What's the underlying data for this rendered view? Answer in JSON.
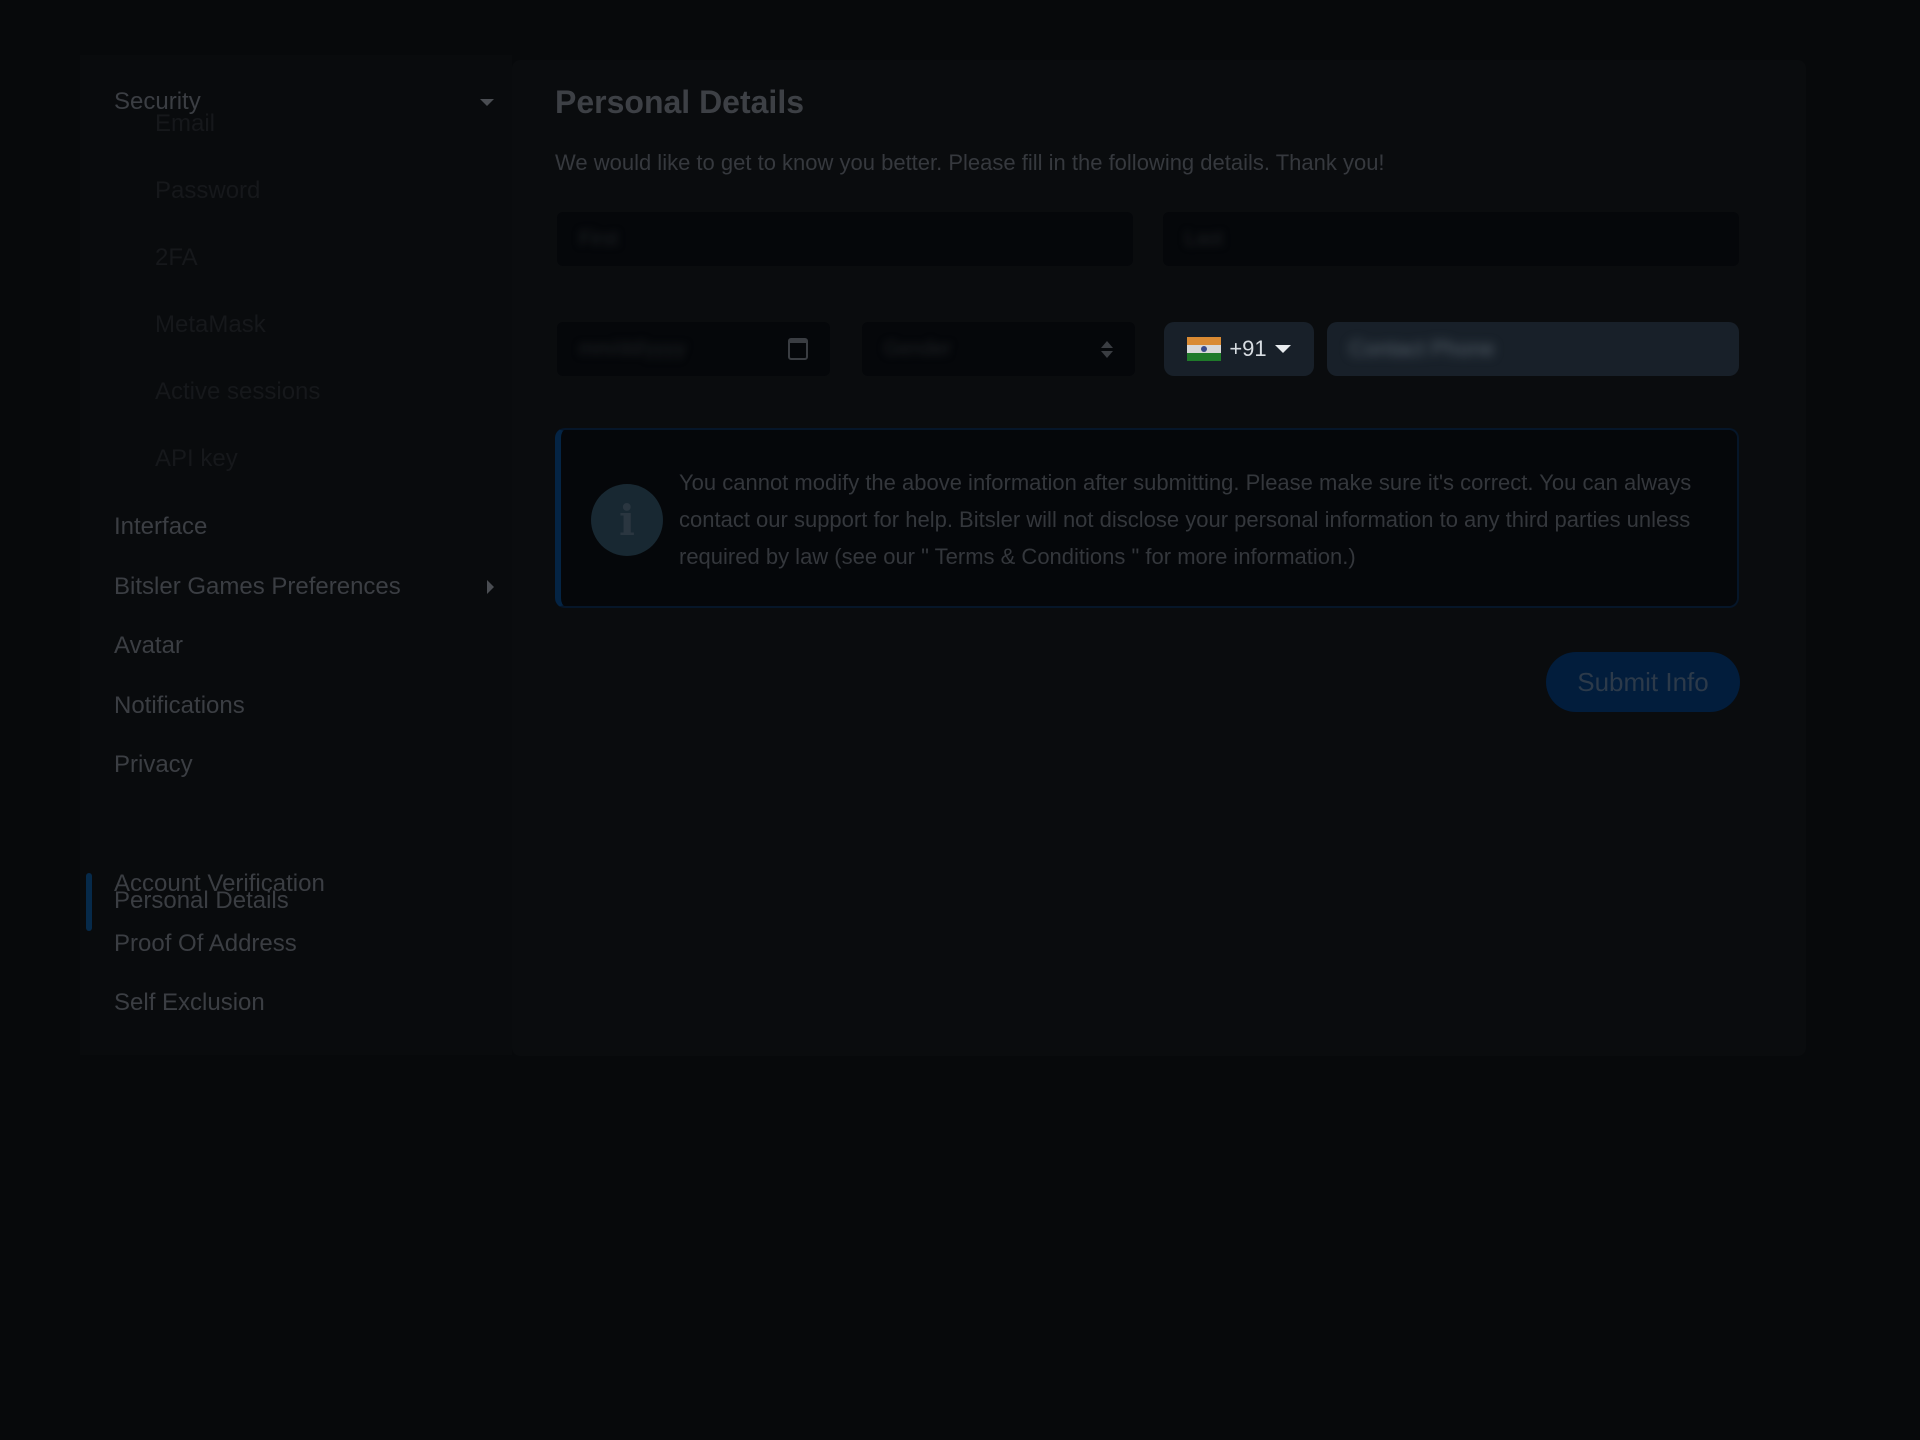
{
  "sidebar": {
    "security": {
      "label": "Security",
      "expanded": true,
      "items": [
        {
          "label": "Email"
        },
        {
          "label": "Password"
        },
        {
          "label": "2FA"
        },
        {
          "label": "MetaMask"
        },
        {
          "label": "Active sessions"
        },
        {
          "label": "API key"
        }
      ]
    },
    "items": [
      {
        "label": "Interface"
      },
      {
        "label": "Bitsler Games Preferences",
        "has_submenu": true
      },
      {
        "label": "Avatar"
      },
      {
        "label": "Notifications"
      },
      {
        "label": "Privacy"
      },
      {
        "label": "Personal Details",
        "active": true
      },
      {
        "label": "Account Verification"
      },
      {
        "label": "Proof Of Address"
      },
      {
        "label": "Self Exclusion"
      }
    ]
  },
  "main": {
    "title": "Personal Details",
    "subtitle": "We would like to get to know you better. Please fill in the following details. Thank you!",
    "fields": {
      "first_name_placeholder": "First",
      "last_name_placeholder": "Last",
      "birthdate_placeholder": "mm/dd/yyyy",
      "gender_placeholder": "Gender",
      "phone_prefix": "+91",
      "phone_country": "India",
      "phone_placeholder": "Contact Phone"
    },
    "info": {
      "icon": "info-icon",
      "text": "You cannot modify the above information after submitting. Please make sure it's correct. You can always contact our support for help. Bitsler will not disclose your personal information to any third parties unless required by law (see our \" Terms & Conditions \" for more information.)"
    },
    "submit_label": "Submit Info"
  },
  "colors": {
    "accent": "#042444",
    "background": "#07090b"
  }
}
